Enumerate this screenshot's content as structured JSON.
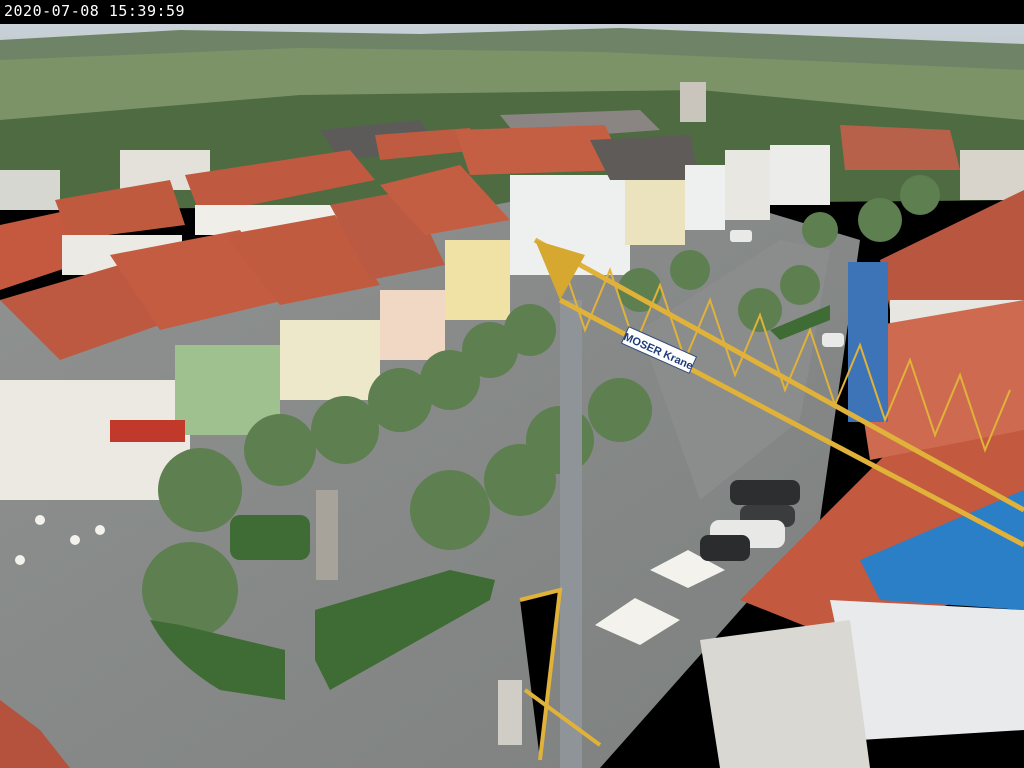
{
  "overlay": {
    "timestamp": "2020-07-08 15:39:59"
  },
  "scene": {
    "crane_sign": "MOSER Krane"
  }
}
